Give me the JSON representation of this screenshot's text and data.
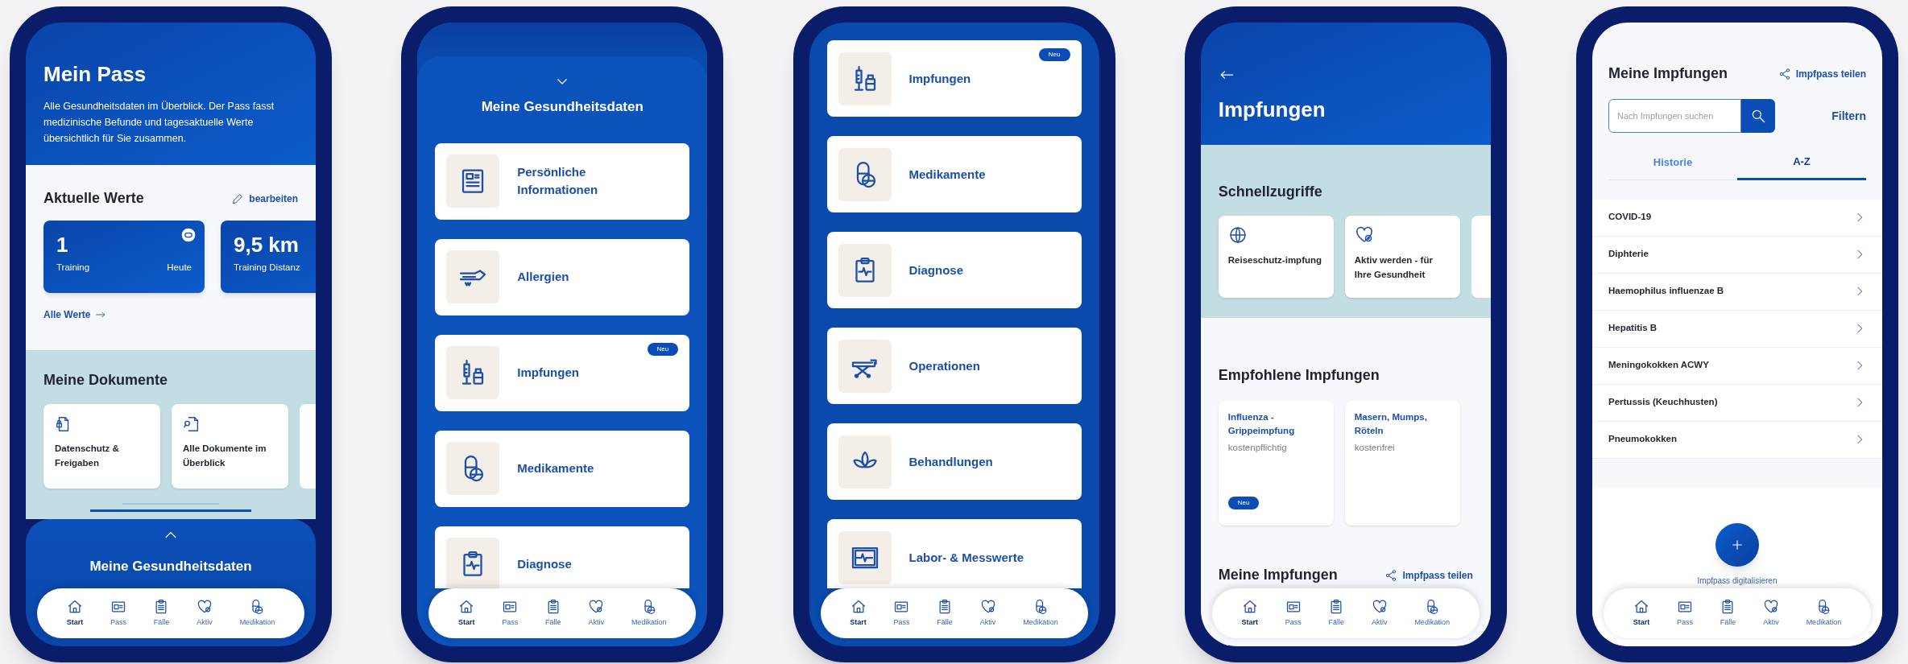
{
  "phones": [
    {
      "kind": "overview",
      "title": "Mein Pass",
      "intro": "Alle Gesundheitsdaten im Überblick. Der Pass fasst medizinische Befunde und tagesaktuelle Werte übersichtlich für Sie zusammen.",
      "values_heading": "Aktuelle Werte",
      "edit_link": "bearbeiten",
      "value_cards": [
        {
          "value": "1",
          "label": "Training",
          "period": "Heute"
        },
        {
          "value": "9,5 km",
          "label": "Training Distanz"
        }
      ],
      "all_values_link": "Alle Werte",
      "documents_heading": "Meine Dokumente",
      "document_cards": [
        "Datenschutz & Freigaben",
        "Alle Dokumente im Überblick"
      ],
      "sheet_title": "Meine Gesundheitsdaten",
      "nav": [
        {
          "label": "Start",
          "selected": true
        },
        {
          "label": "Pass",
          "selected": false
        },
        {
          "label": "Fälle",
          "selected": false
        },
        {
          "label": "Aktiv",
          "selected": false
        },
        {
          "label": "Medikation",
          "selected": false
        }
      ]
    },
    {
      "kind": "data_list",
      "sheet_title": "Meine Gesundheitsdaten",
      "items": [
        {
          "label": "Persönliche Informationen"
        },
        {
          "label": "Allergien"
        },
        {
          "label": "Impfungen",
          "badge": "Neu"
        },
        {
          "label": "Medikamente"
        },
        {
          "label": "Diagnose"
        }
      ],
      "nav": [
        {
          "label": "Start",
          "selected": true
        },
        {
          "label": "Pass",
          "selected": false
        },
        {
          "label": "Fälle",
          "selected": false
        },
        {
          "label": "Aktiv",
          "selected": false
        },
        {
          "label": "Medikation",
          "selected": false
        }
      ]
    },
    {
      "kind": "data_list",
      "items": [
        {
          "label": "Impfungen",
          "badge": "Neu"
        },
        {
          "label": "Medikamente"
        },
        {
          "label": "Diagnose"
        },
        {
          "label": "Operationen"
        },
        {
          "label": "Behandlungen"
        },
        {
          "label": "Labor- & Messwerte"
        }
      ],
      "nav": [
        {
          "label": "Start",
          "selected": true
        },
        {
          "label": "Pass",
          "selected": false
        },
        {
          "label": "Fälle",
          "selected": false
        },
        {
          "label": "Aktiv",
          "selected": false
        },
        {
          "label": "Medikation",
          "selected": false
        }
      ]
    },
    {
      "kind": "vaccinations",
      "title": "Impfungen",
      "quick_heading": "Schnellzugriffe",
      "quick_cards": [
        "Reiseschutz-impfung",
        "Aktiv werden - für Ihre Gesundheit"
      ],
      "recommended_heading": "Empfohlene Impfungen",
      "recommended": [
        {
          "title": "Influenza - Grippeimpfung",
          "note": "kostenpflichtig",
          "badge": "Neu"
        },
        {
          "title": "Masern, Mumps, Röteln",
          "note": "kostenfrei"
        }
      ],
      "my_heading": "Meine Impfungen",
      "share_link": "Impfpass teilen",
      "nav": [
        {
          "label": "Start",
          "selected": true
        },
        {
          "label": "Pass",
          "selected": false
        },
        {
          "label": "Fälle",
          "selected": false
        },
        {
          "label": "Aktiv",
          "selected": false
        },
        {
          "label": "Medikation",
          "selected": false
        }
      ]
    },
    {
      "kind": "vaccine_list",
      "title": "Meine Impfungen",
      "share_link": "Impfpass teilen",
      "search": {
        "placeholder": "Nach Impfungen suchen"
      },
      "filter_link": "Filtern",
      "tabs": [
        {
          "label": "Historie",
          "selected": false
        },
        {
          "label": "A-Z",
          "selected": true
        }
      ],
      "vaccines": [
        "COVID-19",
        "Diphterie",
        "Haemophilus influenzae B",
        "Hepatitis B",
        "Meningokokken ACWY",
        "Pertussis (Keuchhusten)",
        "Pneumokokken"
      ],
      "fab_label": "Impfpass digitalisieren",
      "nav": [
        {
          "label": "Start",
          "selected": true
        },
        {
          "label": "Pass",
          "selected": false
        },
        {
          "label": "Fälle",
          "selected": false
        },
        {
          "label": "Aktiv",
          "selected": false
        },
        {
          "label": "Medikation",
          "selected": false
        }
      ]
    }
  ]
}
